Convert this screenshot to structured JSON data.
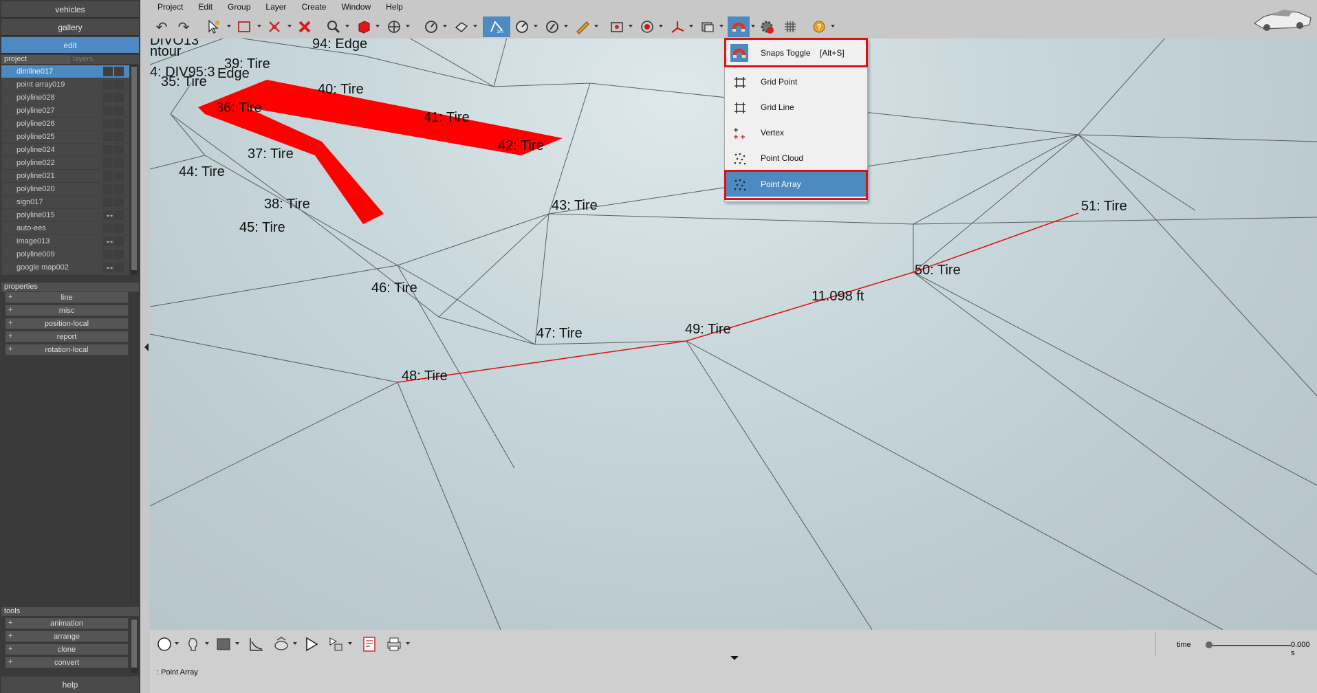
{
  "left_panel": {
    "nav": [
      "vehicles",
      "gallery",
      "edit"
    ],
    "tabs": {
      "project": "project",
      "layers": "layers"
    },
    "project_items": [
      "dimline017",
      "point array019",
      "polyline028",
      "polyline027",
      "polyline026",
      "polyline025",
      "polyline024",
      "polyline022",
      "polyline021",
      "polyline020",
      "sign017",
      "polyline015",
      "auto-ees",
      "image013",
      "polyline009",
      "google map002"
    ],
    "eye_glyph": "👓",
    "properties_header": "properties",
    "properties": [
      "line",
      "misc",
      "position-local",
      "report",
      "rotation-local"
    ],
    "tools_header": "tools",
    "tools": [
      "animation",
      "arrange",
      "clone",
      "convert"
    ],
    "help": "help",
    "plus": "+"
  },
  "menubar": [
    "Project",
    "Edit",
    "Group",
    "Layer",
    "Create",
    "Window",
    "Help"
  ],
  "viewport": {
    "labels": {
      "l_contour_a": "DIVO13",
      "l_contour_b": "ntour",
      "l94": "94: Edge",
      "l39": "39: Tire",
      "l4": "4: DIV95:3",
      "l95": "Edge",
      "l35": "35: Tire",
      "l40": "40: Tire",
      "l36": "36: Tire",
      "l41": "41: Tire",
      "l42": "42: Tire",
      "l37": "37: Tire",
      "l44": "44: Tire",
      "l38": "38: Tire",
      "l43": "43: Tire",
      "l51": "51: Tire",
      "l45": "45: Tire",
      "l50": "50: Tire",
      "l46": "46: Tire",
      "ldim": "11.098 ft",
      "l49": "49: Tire",
      "l47": "47: Tire",
      "l48": "48: Tire"
    }
  },
  "snap_menu": {
    "items": [
      {
        "label": "Snaps Toggle",
        "shortcut": "[Alt+S]"
      },
      {
        "label": "Grid Point"
      },
      {
        "label": "Grid Line"
      },
      {
        "label": "Vertex"
      },
      {
        "label": "Point Cloud"
      },
      {
        "label": "Point Array"
      }
    ]
  },
  "bottom": {
    "status": ": Point Array",
    "time_label": "time",
    "time_value": "0.000 s"
  },
  "colors": {
    "accent": "#4d8ac2",
    "highlight_red": "#e01010",
    "path_red": "#ff0000"
  }
}
